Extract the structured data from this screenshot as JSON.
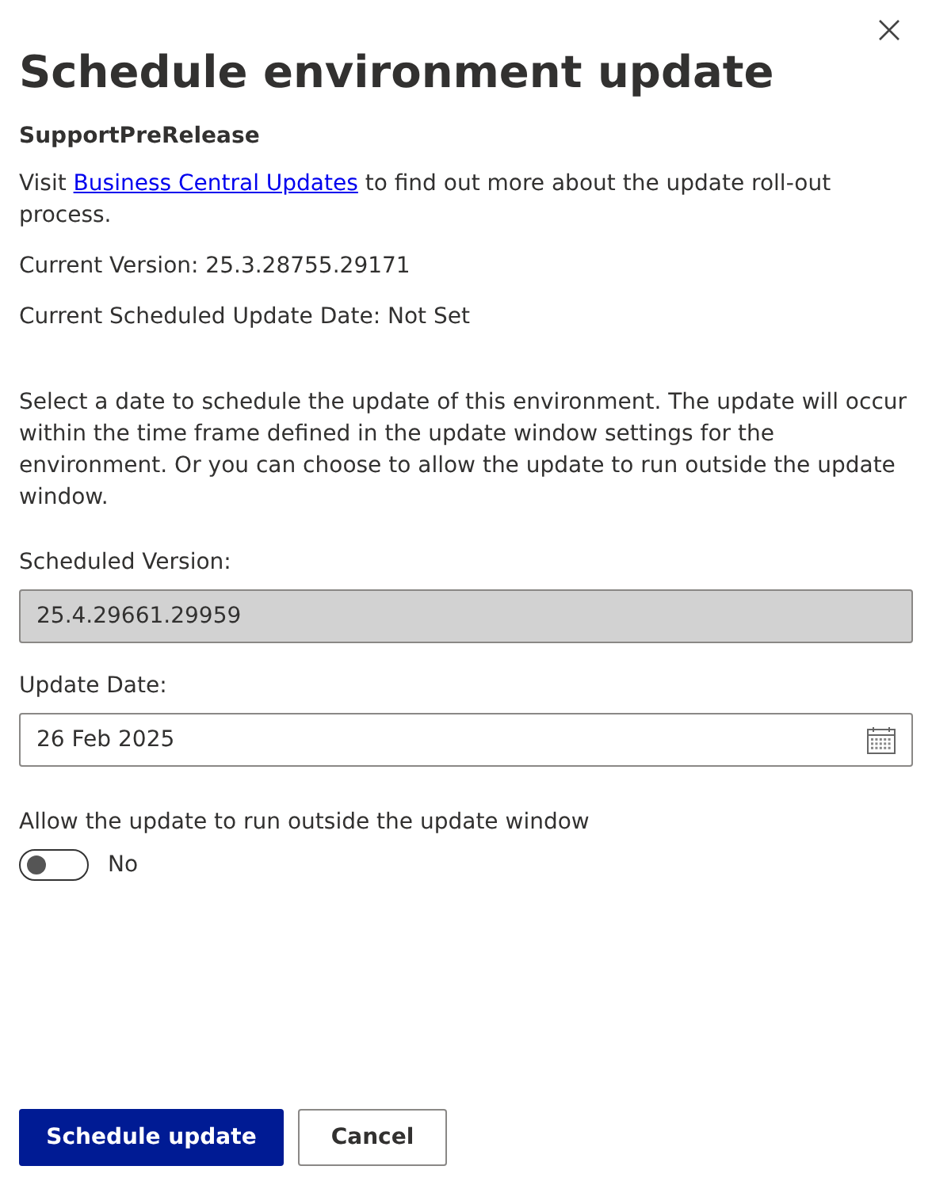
{
  "title": "Schedule environment update",
  "environment": "SupportPreRelease",
  "intro": {
    "before": "Visit ",
    "link": "Business Central Updates",
    "after": " to find out more about the update roll-out process."
  },
  "current_version": "Current Version: 25.3.28755.29171",
  "current_scheduled": "Current Scheduled Update Date: Not Set",
  "description": "Select a date to schedule the update of this environment. The update will occur within the time frame defined in the update window settings for the environment. Or you can choose to allow the update to run outside the update window.",
  "fields": [
    {
      "label": "Scheduled Version:",
      "value": "25.4.29661.29959",
      "disabled": true,
      "kind": "text"
    },
    {
      "label": "Update Date:",
      "value": "26 Feb 2025",
      "disabled": false,
      "kind": "date"
    }
  ],
  "toggle": {
    "label": "Allow the update to run outside the update window",
    "on": false,
    "state_text": "No"
  },
  "buttons": [
    {
      "label": "Schedule update",
      "primary": true
    },
    {
      "label": "Cancel",
      "primary": false
    }
  ]
}
